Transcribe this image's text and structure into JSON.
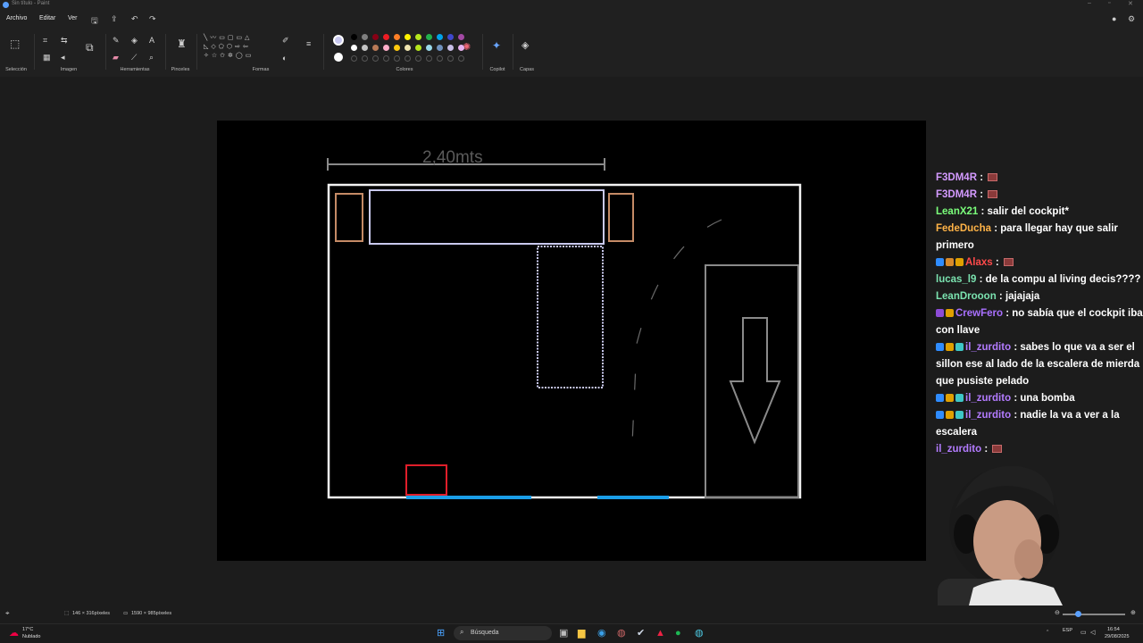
{
  "window": {
    "title": "Sin título - Paint"
  },
  "menu": {
    "items": [
      "Archivo",
      "Editar",
      "Ver"
    ]
  },
  "ribbon": {
    "groups": [
      "Selección",
      "Imagen",
      "Herramientas",
      "Pinceles",
      "Formas",
      "Colores",
      "Copilot",
      "Capas"
    ]
  },
  "colors": {
    "primary": "#c8c8f0",
    "secondary": "#ffffff",
    "palette_row1": [
      "#000000",
      "#7f7f7f",
      "#880015",
      "#ed1c24",
      "#ff7f27",
      "#fff200",
      "#b5e61d",
      "#22b14c",
      "#00a2e8",
      "#3f48cc",
      "#a349a4"
    ],
    "palette_row2": [
      "#ffffff",
      "#c3c3c3",
      "#b97a57",
      "#ffaec9",
      "#ffc90e",
      "#efe4b0",
      "#b5e61d",
      "#99d9ea",
      "#7092be",
      "#c8bfe7",
      "#e6b3f0"
    ]
  },
  "canvas": {
    "dimension_label": "2,40mts"
  },
  "status": {
    "selection_size": "146 × 316píxeles",
    "canvas_size": "1590 × 985píxeles"
  },
  "chat": [
    {
      "user": "F3DM4R",
      "color": "#d49aff",
      "text": "",
      "emote": true,
      "badges": []
    },
    {
      "user": "F3DM4R",
      "color": "#d49aff",
      "text": "",
      "emote": true,
      "badges": []
    },
    {
      "user": "LeanX21",
      "color": "#7bff7b",
      "text": "salir del cockpit*",
      "emote": false,
      "badges": []
    },
    {
      "user": "FedeDucha",
      "color": "#ffb347",
      "text": "para llegar hay que salir primero",
      "emote": false,
      "badges": []
    },
    {
      "user": "Alaxs",
      "color": "#ff4a4a",
      "text": "",
      "emote": true,
      "badges": [
        "#2f8cff",
        "#d88a2b",
        "#e0a000"
      ]
    },
    {
      "user": "lucas_l9",
      "color": "#7be3b0",
      "text": "de la compu al living decis????",
      "emote": false,
      "badges": []
    },
    {
      "user": "LeanDrooon",
      "color": "#7be3b0",
      "text": "jajajaja",
      "emote": false,
      "badges": []
    },
    {
      "user": "CrewFero",
      "color": "#a970ff",
      "text": "no sabía que el cockpit iba con llave",
      "emote": false,
      "badges": [
        "#8c4bd6",
        "#e0a000"
      ]
    },
    {
      "user": "il_zurdito",
      "color": "#b37bff",
      "text": "sabes lo que va a ser el sillon ese al lado de la escalera de mierda que pusiste pelado",
      "emote": false,
      "badges": [
        "#2f8cff",
        "#e0a000",
        "#3ec6c6"
      ]
    },
    {
      "user": "il_zurdito",
      "color": "#b37bff",
      "text": "una bomba",
      "emote": false,
      "badges": [
        "#2f8cff",
        "#e0a000",
        "#3ec6c6"
      ]
    },
    {
      "user": "il_zurdito",
      "color": "#b37bff",
      "text": "nadie la va a ver a la escalera",
      "emote": false,
      "badges": [
        "#2f8cff",
        "#e0a000",
        "#3ec6c6"
      ]
    },
    {
      "user": "il_zurdito",
      "color": "#b37bff",
      "text": "",
      "emote": true,
      "badges": []
    }
  ],
  "taskbar": {
    "search_placeholder": "Búsqueda",
    "weather_temp": "17°C",
    "weather_desc": "Nublado",
    "lang": "ESP",
    "time": "16:54",
    "date": "29/08/2025"
  }
}
